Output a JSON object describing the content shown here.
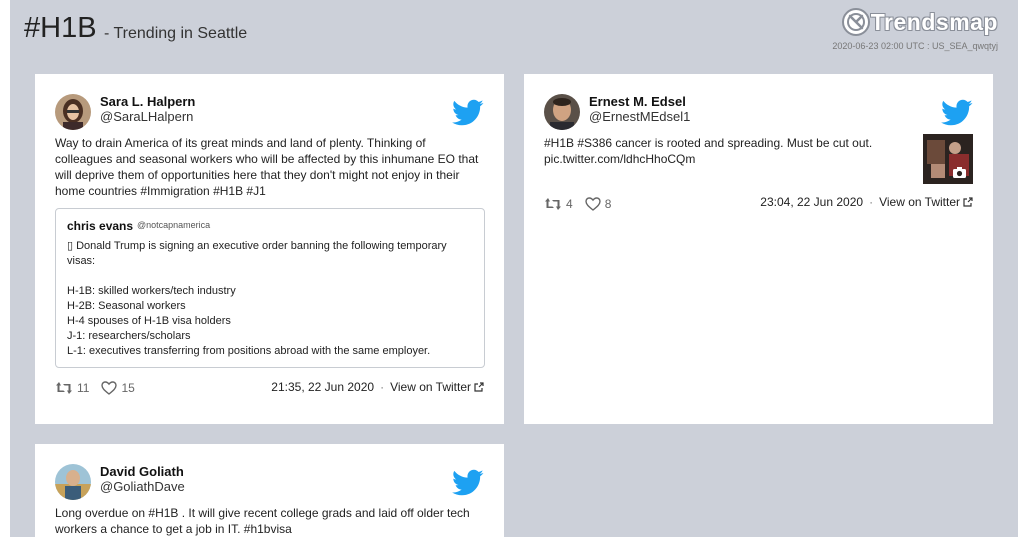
{
  "header": {
    "hashtag": "#H1B",
    "subtitle": "- Trending in Seattle",
    "brand": "Trendsmap",
    "stamp": "2020-06-23 02:00 UTC : US_SEA_qwqtyj"
  },
  "colors": {
    "page_bg": "#ccd0d9",
    "card_bg": "#ffffff",
    "twitter_blue": "#1da1f2"
  },
  "tweets": [
    {
      "name": "Sara L. Halpern",
      "handle": "@SaraLHalpern",
      "text": "Way to drain America of its great minds and land of plenty. Thinking of colleagues and seasonal workers who will be affected by this inhumane EO that will deprive them of opportunities here that they don't might not enjoy in their home countries #Immigration #H1B #J1",
      "quote": {
        "name": "chris evans",
        "handle": "@notcapnamerica",
        "lines": [
          "▯ Donald Trump is signing an executive order banning the following temporary visas:",
          "",
          "H-1B: skilled workers/tech industry",
          "H-2B: Seasonal workers",
          "H-4 spouses of H-1B visa holders",
          "J-1: researchers/scholars",
          "L-1: executives transferring from positions abroad with the same employer."
        ]
      },
      "retweets": "11",
      "likes": "15",
      "time": "21:35, 22 Jun 2020",
      "view_label": "View on Twitter"
    },
    {
      "name": "Ernest M. Edsel",
      "handle": "@ErnestMEdsel1",
      "text": "#H1B #S386 cancer is rooted and spreading. Must be cut out. pic.twitter.com/ldhcHhoCQm",
      "retweets": "4",
      "likes": "8",
      "time": "23:04, 22 Jun 2020",
      "view_label": "View on Twitter",
      "media_icon": "camera-icon"
    },
    {
      "name": "David Goliath",
      "handle": "@GoliathDave",
      "text": "Long overdue on #H1B . It will give recent college grads and laid off older tech workers a chance to get a job in IT. #h1bvisa"
    }
  ]
}
